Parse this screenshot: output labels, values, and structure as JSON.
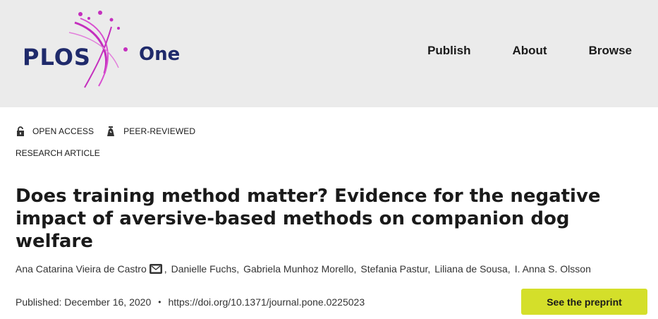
{
  "header": {
    "logo": {
      "brand": "PLOS",
      "journal": "One",
      "accent_color": "#c42fbe",
      "text_color": "#1f2a6b"
    },
    "nav": [
      {
        "label": "Publish"
      },
      {
        "label": "About"
      },
      {
        "label": "Browse"
      }
    ],
    "background": "#ebebeb"
  },
  "article": {
    "badges": [
      {
        "icon": "lock-open-icon",
        "label": "OPEN ACCESS"
      },
      {
        "icon": "peer-review-icon",
        "label": "PEER-REVIEWED"
      }
    ],
    "type": "RESEARCH ARTICLE",
    "title": "Does training method matter? Evidence for the negative impact of aversive-based methods on companion dog welfare",
    "authors": [
      "Ana Catarina Vieira de Castro",
      "Danielle Fuchs,",
      "Gabriela Munhoz Morello,",
      "Stefania Pastur,",
      "Liliana de Sousa,",
      "I. Anna S. Olsson"
    ],
    "corresponding_icon": "mail-icon",
    "published": "Published: December 16, 2020",
    "separator": "•",
    "doi": "https://doi.org/10.1371/journal.pone.0225023",
    "preprint_button": "See the preprint",
    "button_color": "#d4df2a"
  }
}
